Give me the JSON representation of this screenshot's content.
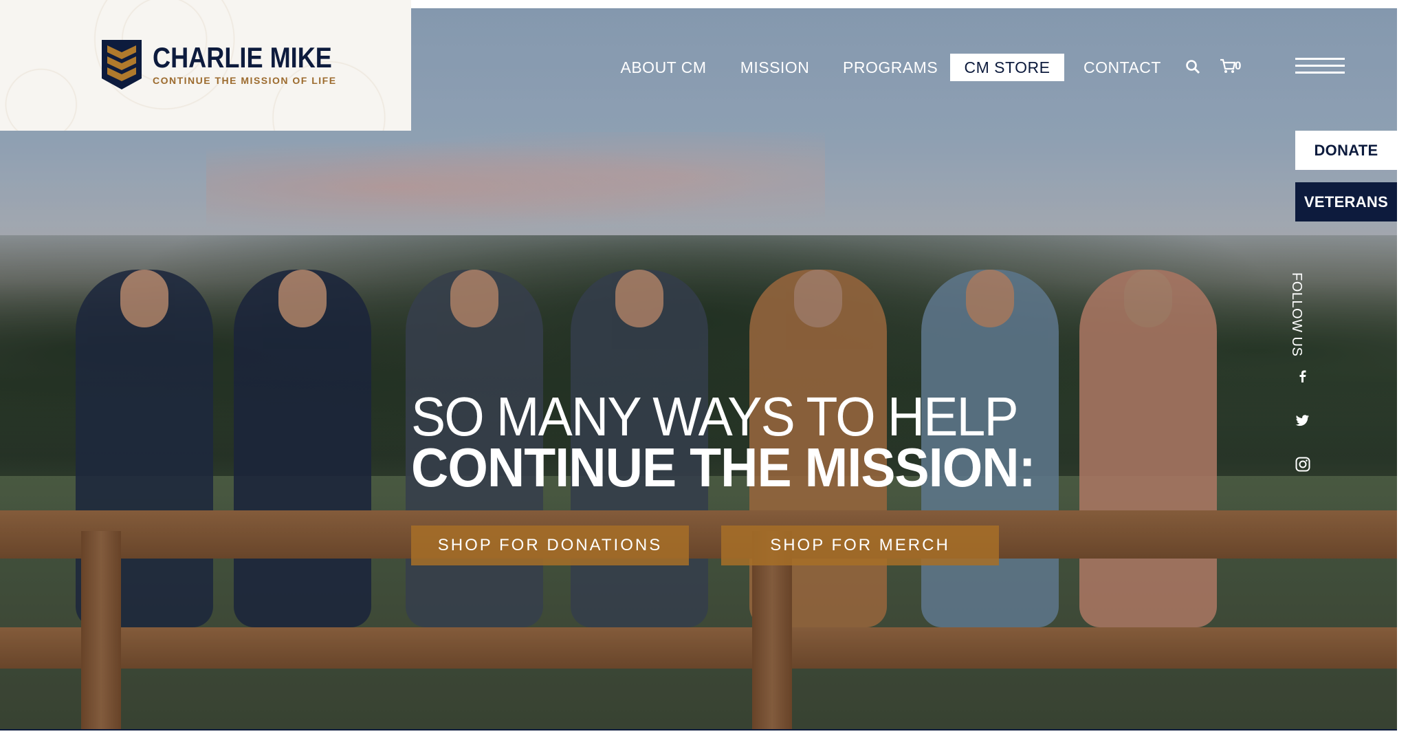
{
  "brand": {
    "name": "CHARLIE MIKE",
    "tagline": "CONTINUE THE MISSION OF LIFE"
  },
  "nav": {
    "items": [
      {
        "label": "ABOUT CM"
      },
      {
        "label": "MISSION"
      },
      {
        "label": "PROGRAMS"
      },
      {
        "label": "CM STORE",
        "active": true
      },
      {
        "label": "CONTACT"
      }
    ],
    "search_icon": "search-icon",
    "cart_icon": "cart-icon",
    "cart_count": "0",
    "menu_icon": "hamburger-menu-icon"
  },
  "side": {
    "donate_label": "DONATE",
    "veterans_label": "VETERANS",
    "follow_label": "FOLLOW US",
    "social": [
      "facebook-icon",
      "twitter-icon",
      "instagram-icon"
    ]
  },
  "hero": {
    "line1": "SO MANY WAYS TO HELP",
    "line2": "CONTINUE THE MISSION:",
    "cta_donations": "SHOP FOR DONATIONS",
    "cta_merch": "SHOP FOR MERCH"
  },
  "colors": {
    "navy": "#0d1b3d",
    "gold": "#a66f28",
    "white": "#ffffff"
  }
}
